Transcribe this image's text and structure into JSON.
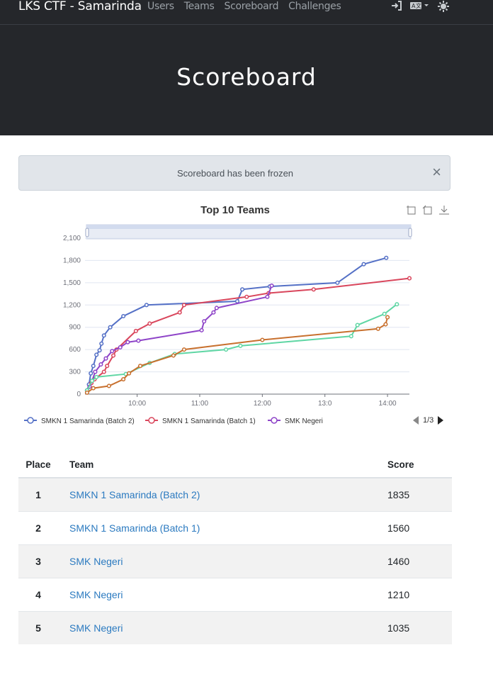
{
  "navbar": {
    "brand": "LKS CTF - Samarinda",
    "links": [
      "Users",
      "Teams",
      "Scoreboard",
      "Challenges"
    ],
    "icons": [
      "login-icon",
      "language-icon",
      "theme-icon"
    ]
  },
  "page_title": "Scoreboard",
  "alert": {
    "message": "Scoreboard has been frozen",
    "close": "×"
  },
  "chart_data": {
    "type": "line",
    "title": "Top 10 Teams",
    "x_ticks": [
      "10:00",
      "11:00",
      "12:00",
      "13:0",
      "14:00"
    ],
    "y_ticks": [
      "0",
      "300",
      "600",
      "900",
      "1,200",
      "1,500",
      "1,800",
      "2,100"
    ],
    "ylim": [
      0,
      2100
    ],
    "x_unit": "time (hours of day)",
    "legend": {
      "position": "bottom-left",
      "page": "1/3"
    },
    "series": [
      {
        "name": "SMKN 1 Samarinda (Batch 2)",
        "color": "#5470c6",
        "points": [
          [
            9.2,
            50
          ],
          [
            9.23,
            130
          ],
          [
            9.26,
            280
          ],
          [
            9.3,
            380
          ],
          [
            9.35,
            530
          ],
          [
            9.4,
            590
          ],
          [
            9.43,
            680
          ],
          [
            9.47,
            790
          ],
          [
            9.57,
            900
          ],
          [
            9.78,
            1050
          ],
          [
            10.15,
            1200
          ],
          [
            11.6,
            1250
          ],
          [
            11.68,
            1410
          ],
          [
            12.12,
            1450
          ],
          [
            13.2,
            1500
          ],
          [
            13.62,
            1750
          ],
          [
            13.98,
            1835
          ]
        ]
      },
      {
        "name": "SMKN 1 Samarinda (Batch 1)",
        "color": "#d9465c",
        "points": [
          [
            9.2,
            50
          ],
          [
            9.24,
            100
          ],
          [
            9.27,
            150
          ],
          [
            9.32,
            200
          ],
          [
            9.47,
            300
          ],
          [
            9.52,
            380
          ],
          [
            9.62,
            520
          ],
          [
            9.67,
            600
          ],
          [
            9.98,
            850
          ],
          [
            10.2,
            950
          ],
          [
            10.68,
            1100
          ],
          [
            10.75,
            1200
          ],
          [
            11.75,
            1310
          ],
          [
            12.1,
            1360
          ],
          [
            12.82,
            1410
          ],
          [
            14.35,
            1560
          ]
        ]
      },
      {
        "name": "SMK Negeri",
        "color": "#8e44c8",
        "points": [
          [
            9.2,
            50
          ],
          [
            9.24,
            100
          ],
          [
            9.28,
            180
          ],
          [
            9.33,
            300
          ],
          [
            9.42,
            400
          ],
          [
            9.5,
            480
          ],
          [
            9.6,
            580
          ],
          [
            9.73,
            630
          ],
          [
            9.85,
            700
          ],
          [
            10.02,
            720
          ],
          [
            11.03,
            860
          ],
          [
            11.07,
            980
          ],
          [
            11.22,
            1100
          ],
          [
            11.27,
            1160
          ],
          [
            12.08,
            1310
          ],
          [
            12.15,
            1460
          ]
        ]
      },
      {
        "name": "SMK Negeri",
        "color": "#5fd6a4",
        "points": [
          [
            9.2,
            50
          ],
          [
            9.28,
            180
          ],
          [
            9.35,
            230
          ],
          [
            9.82,
            270
          ],
          [
            10.2,
            420
          ],
          [
            10.6,
            540
          ],
          [
            11.42,
            600
          ],
          [
            11.65,
            650
          ],
          [
            13.42,
            780
          ],
          [
            13.52,
            930
          ],
          [
            13.95,
            1080
          ],
          [
            14.15,
            1210
          ]
        ]
      },
      {
        "name": "SMK Negeri",
        "color": "#c8702e",
        "points": [
          [
            9.2,
            20
          ],
          [
            9.3,
            80
          ],
          [
            9.55,
            110
          ],
          [
            9.78,
            200
          ],
          [
            9.87,
            280
          ],
          [
            10.05,
            380
          ],
          [
            10.58,
            520
          ],
          [
            10.75,
            600
          ],
          [
            12.0,
            730
          ],
          [
            13.85,
            880
          ],
          [
            13.97,
            940
          ],
          [
            14.0,
            1035
          ]
        ]
      }
    ]
  },
  "table": {
    "headers": {
      "place": "Place",
      "team": "Team",
      "score": "Score"
    },
    "rows": [
      {
        "place": "1",
        "team": "SMKN 1 Samarinda (Batch 2)",
        "score": "1835"
      },
      {
        "place": "2",
        "team": "SMKN 1 Samarinda (Batch 1)",
        "score": "1560"
      },
      {
        "place": "3",
        "team": "SMK Negeri",
        "score": "1460"
      },
      {
        "place": "4",
        "team": "SMK Negeri",
        "score": "1210"
      },
      {
        "place": "5",
        "team": "SMK Negeri",
        "score": "1035"
      }
    ]
  }
}
